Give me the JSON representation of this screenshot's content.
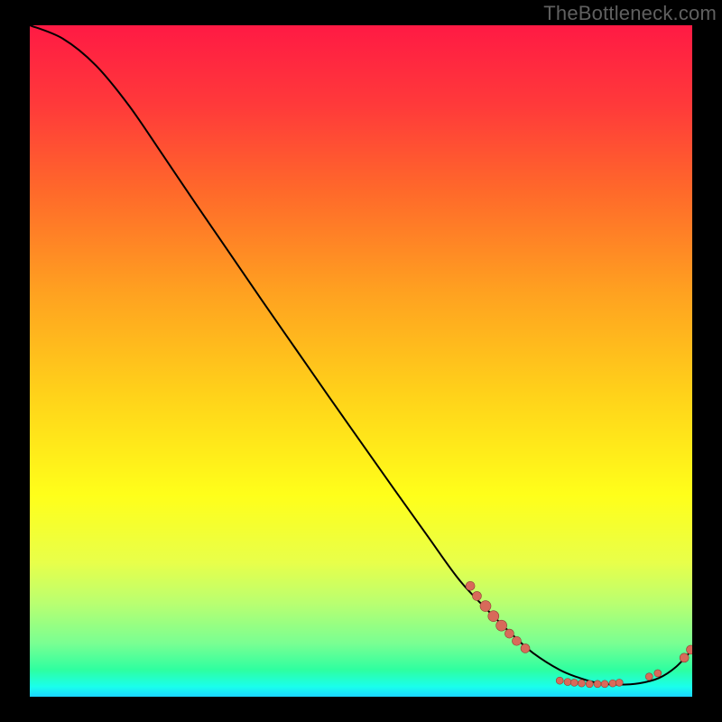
{
  "watermark": "TheBottleneck.com",
  "colors": {
    "dot_fill": "#d86a5a",
    "dot_stroke": "#903f34",
    "curve": "#000000",
    "frame_bg": "#000000"
  },
  "chart_data": {
    "type": "line",
    "title": "",
    "xlabel": "",
    "ylabel": "",
    "xlim": [
      0,
      1
    ],
    "ylim": [
      0,
      1
    ],
    "grid": false,
    "legend": false,
    "note": "Bottleneck-style curve. Axes are normalized to the visible plot area since no tick labels are shown; y runs from 0 (bottom) to 1 (top).",
    "series": [
      {
        "name": "curve",
        "x": [
          0.0,
          0.05,
          0.1,
          0.15,
          0.2,
          0.25,
          0.3,
          0.35,
          0.4,
          0.45,
          0.5,
          0.55,
          0.6,
          0.65,
          0.7,
          0.73,
          0.76,
          0.8,
          0.83,
          0.86,
          0.89,
          0.92,
          0.95,
          0.975,
          1.0
        ],
        "y": [
          1.0,
          0.98,
          0.94,
          0.88,
          0.808,
          0.735,
          0.663,
          0.591,
          0.52,
          0.449,
          0.379,
          0.309,
          0.24,
          0.172,
          0.12,
          0.091,
          0.065,
          0.04,
          0.028,
          0.02,
          0.018,
          0.02,
          0.028,
          0.044,
          0.07
        ]
      }
    ],
    "scatter": {
      "name": "dots",
      "points": [
        {
          "x": 0.665,
          "y": 0.165,
          "r": 5
        },
        {
          "x": 0.675,
          "y": 0.15,
          "r": 5
        },
        {
          "x": 0.688,
          "y": 0.135,
          "r": 6
        },
        {
          "x": 0.7,
          "y": 0.12,
          "r": 6
        },
        {
          "x": 0.712,
          "y": 0.106,
          "r": 6
        },
        {
          "x": 0.724,
          "y": 0.094,
          "r": 5
        },
        {
          "x": 0.735,
          "y": 0.083,
          "r": 5
        },
        {
          "x": 0.748,
          "y": 0.072,
          "r": 5
        },
        {
          "x": 0.8,
          "y": 0.024,
          "r": 4
        },
        {
          "x": 0.812,
          "y": 0.022,
          "r": 4
        },
        {
          "x": 0.822,
          "y": 0.021,
          "r": 4
        },
        {
          "x": 0.833,
          "y": 0.02,
          "r": 4
        },
        {
          "x": 0.845,
          "y": 0.019,
          "r": 4
        },
        {
          "x": 0.857,
          "y": 0.019,
          "r": 4
        },
        {
          "x": 0.868,
          "y": 0.019,
          "r": 4
        },
        {
          "x": 0.88,
          "y": 0.02,
          "r": 4
        },
        {
          "x": 0.89,
          "y": 0.021,
          "r": 4
        },
        {
          "x": 0.935,
          "y": 0.03,
          "r": 4
        },
        {
          "x": 0.948,
          "y": 0.035,
          "r": 4
        },
        {
          "x": 0.988,
          "y": 0.058,
          "r": 5
        },
        {
          "x": 0.998,
          "y": 0.07,
          "r": 5
        }
      ]
    }
  }
}
